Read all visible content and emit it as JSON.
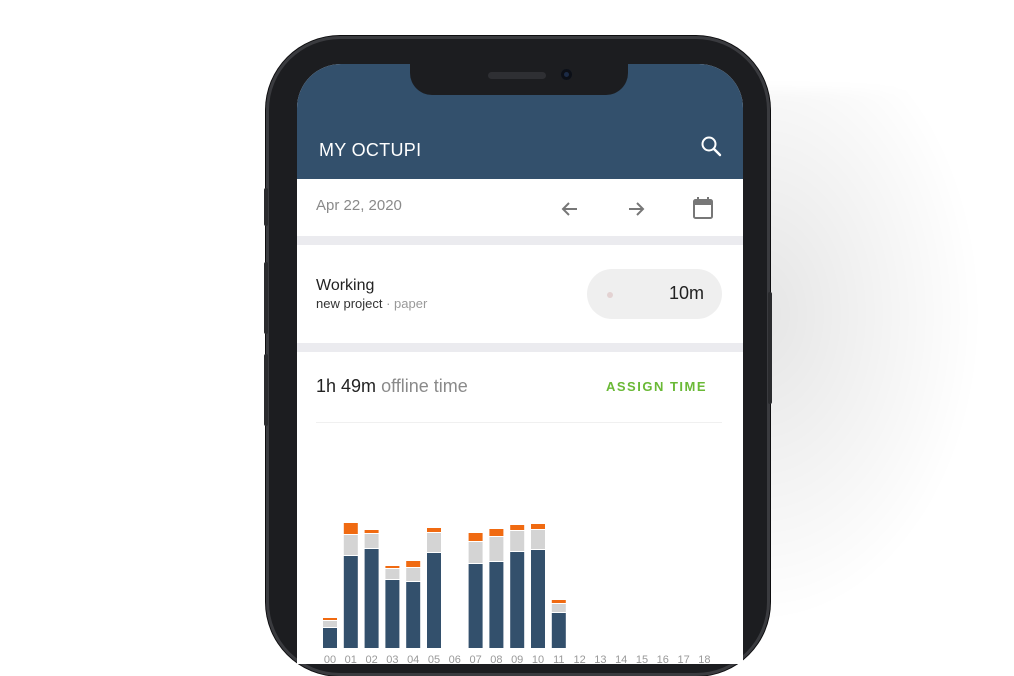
{
  "app": {
    "title": "MY OCTUPI"
  },
  "colors": {
    "appbar": "#33506c",
    "accent_green": "#6ab936",
    "bar_worked": "#33506c",
    "bar_idle": "#d4d4d4",
    "bar_extra": "#f06a11"
  },
  "date_bar": {
    "date": "Apr 22, 2020",
    "prev_icon": "arrow-left-icon",
    "next_icon": "arrow-right-icon",
    "calendar_icon": "calendar-icon"
  },
  "status": {
    "title": "Working",
    "project": "new project",
    "separator": " · ",
    "task": "paper",
    "timer": "10m"
  },
  "offline": {
    "duration": "1h 49m",
    "label": "offline time",
    "assign_label": "ASSIGN TIME"
  },
  "chart_data": {
    "type": "bar",
    "stacked": true,
    "categories": [
      "00",
      "01",
      "02",
      "03",
      "04",
      "05",
      "06",
      "07",
      "08",
      "09",
      "10",
      "11",
      "12",
      "13",
      "14",
      "15",
      "16",
      "17",
      "18"
    ],
    "series": [
      {
        "color": "#33506c",
        "values": [
          20,
          92,
          99,
          68,
          66,
          95,
          0,
          84,
          86,
          96,
          98,
          35,
          0,
          0,
          0,
          0,
          0,
          0,
          0
        ]
      },
      {
        "color": "#d4d4d4",
        "values": [
          6,
          20,
          14,
          10,
          13,
          19,
          0,
          21,
          24,
          20,
          19,
          8,
          0,
          0,
          0,
          0,
          0,
          0,
          0
        ]
      },
      {
        "color": "#f06a11",
        "values": [
          2,
          11,
          3,
          2,
          6,
          4,
          0,
          8,
          7,
          5,
          5,
          3,
          0,
          0,
          0,
          0,
          0,
          0,
          0
        ]
      }
    ]
  }
}
